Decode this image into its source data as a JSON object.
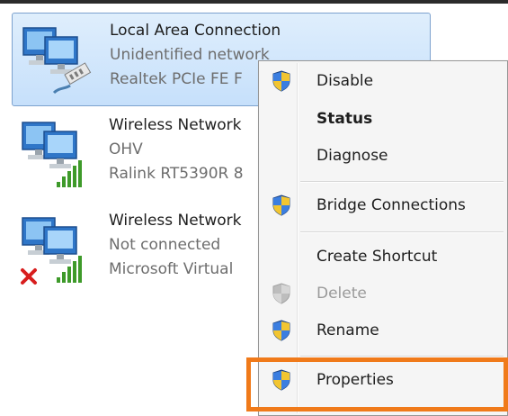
{
  "connections": [
    {
      "name": "Local Area Connection",
      "status": "Unidentified network",
      "adapter": "Realtek PCIe FE F",
      "icon": "wired-network-adapter-icon",
      "selected": true
    },
    {
      "name": "Wireless Network",
      "status": "OHV",
      "adapter": "Ralink RT5390R 8",
      "icon": "wireless-network-adapter-icon",
      "selected": false
    },
    {
      "name": "Wireless Network",
      "status": "Not connected",
      "adapter": "Microsoft Virtual",
      "icon": "wireless-network-disconnected-icon",
      "selected": false
    }
  ],
  "context_menu": {
    "items": [
      {
        "label": "Disable",
        "icon": "uac-shield-icon",
        "bold": false,
        "enabled": true
      },
      {
        "label": "Status",
        "icon": "",
        "bold": true,
        "enabled": true
      },
      {
        "label": "Diagnose",
        "icon": "",
        "bold": false,
        "enabled": true
      },
      {
        "label": "Bridge Connections",
        "icon": "uac-shield-icon",
        "bold": false,
        "enabled": true
      },
      {
        "label": "Create Shortcut",
        "icon": "",
        "bold": false,
        "enabled": true
      },
      {
        "label": "Delete",
        "icon": "uac-shield-icon",
        "bold": false,
        "enabled": false
      },
      {
        "label": "Rename",
        "icon": "uac-shield-icon",
        "bold": false,
        "enabled": true
      },
      {
        "label": "Properties",
        "icon": "uac-shield-icon",
        "bold": false,
        "enabled": true
      }
    ]
  },
  "colors": {
    "highlight_border": "#f07a1a",
    "selection_fill": "#cfe5fc",
    "selection_border": "#7da2ce",
    "menu_background": "#f5f5f5"
  }
}
